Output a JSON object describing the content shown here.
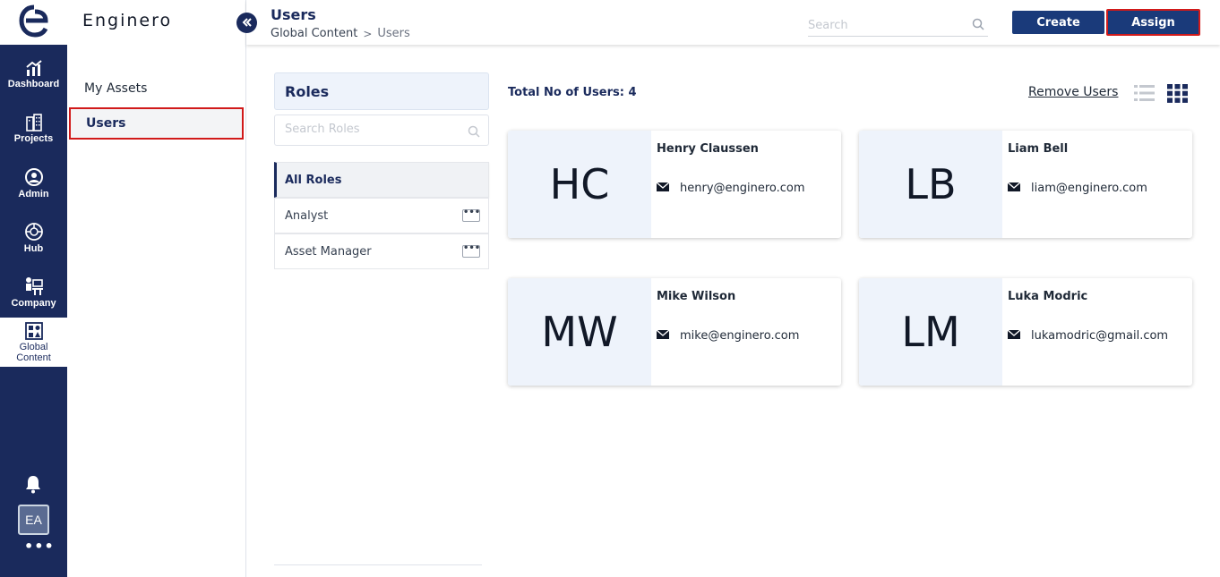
{
  "app": {
    "brand": "Enginero"
  },
  "rail": {
    "items": [
      {
        "label": "Dashboard",
        "icon": "dashboard-icon"
      },
      {
        "label": "Projects",
        "icon": "projects-icon"
      },
      {
        "label": "Admin",
        "icon": "admin-icon"
      },
      {
        "label": "Hub",
        "icon": "hub-icon"
      },
      {
        "label": "Company",
        "icon": "company-icon"
      },
      {
        "label_line1": "Global",
        "label_line2": "Content",
        "icon": "global-content-icon"
      }
    ],
    "avatar_initials": "EA",
    "more": "•••"
  },
  "sidebar": {
    "items": [
      {
        "label": "My Assets"
      },
      {
        "label": "Users"
      }
    ]
  },
  "header": {
    "title": "Users",
    "breadcrumb": {
      "parent": "Global Content",
      "separator": ">",
      "current": "Users"
    },
    "search_placeholder": "Search",
    "create_label": "Create",
    "assign_label": "Assign"
  },
  "roles": {
    "title": "Roles",
    "search_placeholder": "Search Roles",
    "all_label": "All Roles",
    "items": [
      {
        "label": "Analyst",
        "more": "•••"
      },
      {
        "label": "Asset Manager",
        "more": "•••"
      }
    ]
  },
  "users": {
    "total_label": "Total No of Users: 4",
    "remove_label": "Remove Users",
    "cards": [
      {
        "initials": "HC",
        "name": "Henry Claussen",
        "email": "henry@enginero.com"
      },
      {
        "initials": "LB",
        "name": "Liam Bell",
        "email": "liam@enginero.com"
      },
      {
        "initials": "MW",
        "name": "Mike Wilson",
        "email": "mike@enginero.com"
      },
      {
        "initials": "LM",
        "name": "Luka Modric",
        "email": "lukamodric@gmail.com"
      }
    ]
  },
  "colors": {
    "navy": "#1a2a5c",
    "button": "#1a3a7a",
    "highlight": "#d11a1a",
    "card_tint": "#eef3fb"
  }
}
